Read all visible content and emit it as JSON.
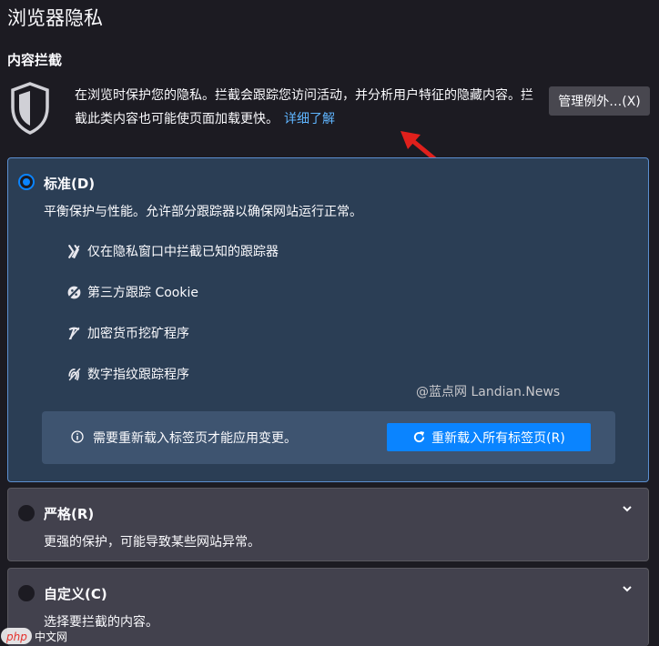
{
  "page": {
    "title": "浏览器隐私"
  },
  "content_blocking": {
    "heading": "内容拦截",
    "description": "在浏览时保护您的隐私。拦截会跟踪您访问活动，并分析用户特征的隐藏内容。拦截此类内容也可能使页面加载更快。",
    "learn_more": "详细了解",
    "manage_exceptions": "管理例外…(X)"
  },
  "options": {
    "standard": {
      "label": "标准(D)",
      "description": "平衡保护与性能。允许部分跟踪器以确保网站运行正常。",
      "selected": true,
      "features": [
        {
          "icon": "tracker-icon",
          "label": "仅在隐私窗口中拦截已知的跟踪器"
        },
        {
          "icon": "cookie-icon",
          "label": "第三方跟踪 Cookie"
        },
        {
          "icon": "cryptominer-icon",
          "label": "加密货币挖矿程序"
        },
        {
          "icon": "fingerprint-icon",
          "label": "数字指纹跟踪程序"
        }
      ],
      "notice": {
        "text": "需要重新载入标签页才能应用变更。",
        "reload_button": "重新载入所有标签页(R)"
      }
    },
    "strict": {
      "label": "严格(R)",
      "description": "更强的保护，可能导致某些网站异常。",
      "selected": false
    },
    "custom": {
      "label": "自定义(C)",
      "description": "选择要拦截的内容。",
      "selected": false
    }
  },
  "watermark": "@蓝点网 Landian.News",
  "php_logo": "php 中文网",
  "colors": {
    "background": "#1c1b22",
    "selected_card": "#2b3e55",
    "selected_border": "#5b8fd0",
    "accent": "#0a84ff",
    "link": "#5fb5ff",
    "annotation_arrow": "#e0201c"
  }
}
